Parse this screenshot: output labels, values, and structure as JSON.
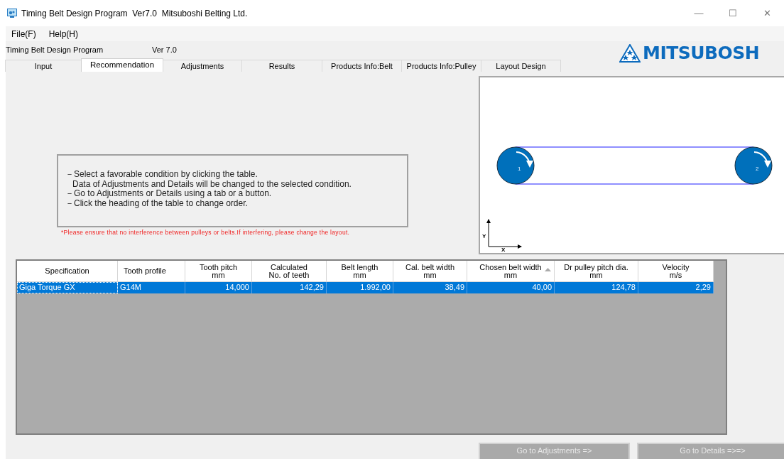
{
  "window": {
    "title": "Timing Belt Design Program  Ver7.0  Mitsuboshi Belting Ltd.",
    "controls": [
      "—",
      "☐",
      "✕"
    ]
  },
  "menu": [
    "File(F)",
    "Help(H)"
  ],
  "header": {
    "program": "Timing Belt Design Program",
    "version": "Ver 7.0",
    "logo": "MITSUBOSH"
  },
  "tabs": [
    {
      "label": "Input",
      "selected": false
    },
    {
      "label": "Recommendation",
      "selected": true
    },
    {
      "label": "Adjustments",
      "selected": false
    },
    {
      "label": "Results",
      "selected": false
    },
    {
      "label": "Products Info:Belt",
      "selected": false
    },
    {
      "label": "Products Info:Pulley",
      "selected": false
    },
    {
      "label": "Layout Design",
      "selected": false
    }
  ],
  "instructions": [
    "－Select a favorable condition by clicking the table.",
    "Data of Adjustments and Details will be changed to the selected condition.",
    "－Go to Adjustments or Details using a tab or a button.",
    "－Click the heading of the table to change order."
  ],
  "warning": "*Please ensure that no interference between pulleys or belts.If interfering, please change the layout.",
  "layout": {
    "pulleys": [
      {
        "label": "1"
      },
      {
        "label": "2"
      }
    ],
    "axes": {
      "x": "X",
      "y": "Y"
    }
  },
  "table": {
    "columns": [
      {
        "label": "Specification",
        "sorted": false
      },
      {
        "label": "Tooth profile",
        "sorted": false
      },
      {
        "label": "Tooth pitch",
        "unit": "mm",
        "sorted": false
      },
      {
        "label": "Calculated",
        "unit": "No. of teeth",
        "sorted": false
      },
      {
        "label": "Belt length",
        "unit": "mm",
        "sorted": false
      },
      {
        "label": "Cal. belt width",
        "unit": "mm",
        "sorted": false
      },
      {
        "label": "Chosen belt width",
        "unit": "mm",
        "sorted": true
      },
      {
        "label": "Dr pulley pitch dia.",
        "unit": "mm",
        "sorted": false
      },
      {
        "label": "Velocity",
        "unit": "m/s",
        "sorted": false
      }
    ],
    "rows": [
      {
        "selected": true,
        "cells": [
          "Giga Torque GX",
          "G14M",
          "14,000",
          "142,29",
          "1.992,00",
          "38,49",
          "40,00",
          "124,78",
          "2,29"
        ]
      }
    ]
  },
  "buttons": [
    "Go to Adjustments =>",
    "Go to Details =>=>"
  ]
}
